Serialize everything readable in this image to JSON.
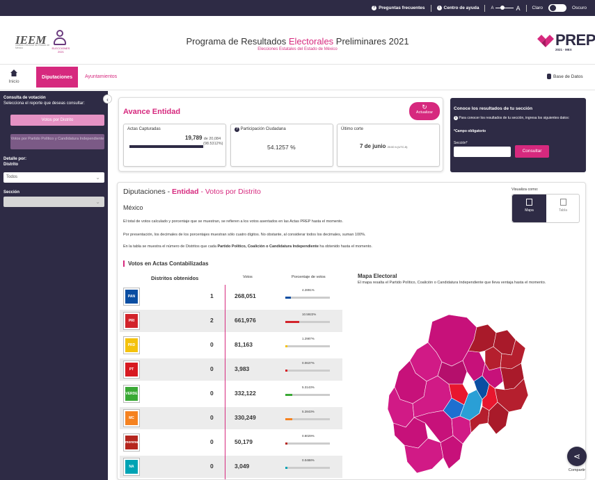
{
  "topbar": {
    "faq": "Preguntas frecuentes",
    "help": "Centro de ayuda",
    "font_small": "A",
    "font_large": "A",
    "mode_light": "Claro",
    "mode_dark": "Oscuro"
  },
  "header": {
    "ieem_logo": "IEEM",
    "ieem_tagline": "Instituto Electoral del Estado de México",
    "figure_caption": "ELECCIONES 2021",
    "title_part1": "Programa de Resultados ",
    "title_part2": "Electorales",
    "title_part3": " Preliminares 2021",
    "subtitle": "Elecciones Estatales del Estado de México",
    "prep_logo": "PREP",
    "prep_sub": "2021 · MEX"
  },
  "nav": {
    "home": "Inicio",
    "tab_active": "Diputaciones",
    "tab2": "Ayuntamientos",
    "database": "Base de Datos"
  },
  "sidebar": {
    "title": "Consulta de votación",
    "subtitle": "Selecciona el reporte que deseas consultar:",
    "btn_distritos": "Votos por Distrito",
    "btn_partido": "Votos por Partido Político y Candidatura Independiente",
    "detalle": "Detalle por:",
    "distrito_label": "Distrito",
    "distrito_value": "Todos",
    "seccion_label": "Sección",
    "seccion_value": ""
  },
  "avance": {
    "title": "Avance Entidad",
    "refresh": "Actualizar",
    "actas_label": "Actas Capturadas",
    "actas_value": "19,789",
    "actas_total": "de 20,084",
    "actas_pct": "(98.5312%)",
    "actas_progress": 0.9853,
    "participacion_label": "Participación Ciudadana",
    "participacion_value": "54.1257 %",
    "corte_label": "Último corte",
    "corte_value": "7 de junio",
    "corte_time": "20:00 h (UTC-5)"
  },
  "consulta": {
    "title": "Conoce los resultados de tu sección",
    "text": "Para conocer los resultados de tu sección, ingresa los siguientes datos:",
    "required": "*Campo obligatorio",
    "seccion_label": "Sección*",
    "button": "Consultar"
  },
  "main": {
    "title_part1": "Diputaciones - ",
    "title_part2": "Entidad",
    "title_part3": " - Votos por Distrito",
    "state": "México",
    "note1": "El total de votos calculado y porcentaje que se muestran, se refieren a los votos asentados en las Actas PREP hasta el momento.",
    "note2": "Por presentación, los decimales de los porcentajes muestran sólo cuatro dígitos. No obstante, al considerar todos los decimales, suman 100%.",
    "note3_a": "En la tabla se muestra el número de Distritos que cada ",
    "note3_b": "Partido Político, Coalición o Candidatura Independiente",
    "note3_c": " ha obtenido hasta el momento.",
    "view_label": "Visualiza como:",
    "view_mapa": "Mapa",
    "view_tabla": "Tabla",
    "votos_header": "Votos en Actas Contabilizadas",
    "col_distritos": "Distritos obtenidos",
    "col_votos": "Votos",
    "col_pct": "Porcentaje de votos",
    "map_title": "Mapa Electoral",
    "map_subtitle": "El mapa resalta el Partido Político, Coalición o Candidatura Independiente que lleva ventaja hasta el momento."
  },
  "parties": [
    {
      "name": "PAN",
      "logo": "PAN",
      "distritos": "1",
      "votos": "268,051",
      "pct": "4.2891%",
      "pct_value": 4.29,
      "color": "#0b4ea2"
    },
    {
      "name": "PRI",
      "logo": "PRI",
      "distritos": "2",
      "votos": "661,976",
      "pct": "10.5922%",
      "pct_value": 10.59,
      "color": "#d2232a"
    },
    {
      "name": "PRD",
      "logo": "PRD",
      "distritos": "0",
      "votos": "81,163",
      "pct": "1.2987%",
      "pct_value": 1.3,
      "color": "#f4c20d"
    },
    {
      "name": "PT",
      "logo": "PT",
      "distritos": "0",
      "votos": "3,983",
      "pct": "0.0637%",
      "pct_value": 0.06,
      "color": "#d71920"
    },
    {
      "name": "VERDE",
      "logo": "VERDE",
      "distritos": "0",
      "votos": "332,122",
      "pct": "5.3143%",
      "pct_value": 5.31,
      "color": "#3aa935"
    },
    {
      "name": "MC",
      "logo": "MC",
      "distritos": "0",
      "votos": "330,249",
      "pct": "5.2843%",
      "pct_value": 5.28,
      "color": "#f58220"
    },
    {
      "name": "MORENA",
      "logo": "morena",
      "distritos": "0",
      "votos": "50,179",
      "pct": "0.8029%",
      "pct_value": 0.8,
      "color": "#b5261e"
    },
    {
      "name": "NA",
      "logo": "NA",
      "distritos": "0",
      "votos": "3,049",
      "pct": "0.0488%",
      "pct_value": 0.05,
      "color": "#00a3b4"
    }
  ],
  "share": "Compartir",
  "colors": {
    "accent": "#d6297e",
    "dark": "#2e2b45"
  }
}
